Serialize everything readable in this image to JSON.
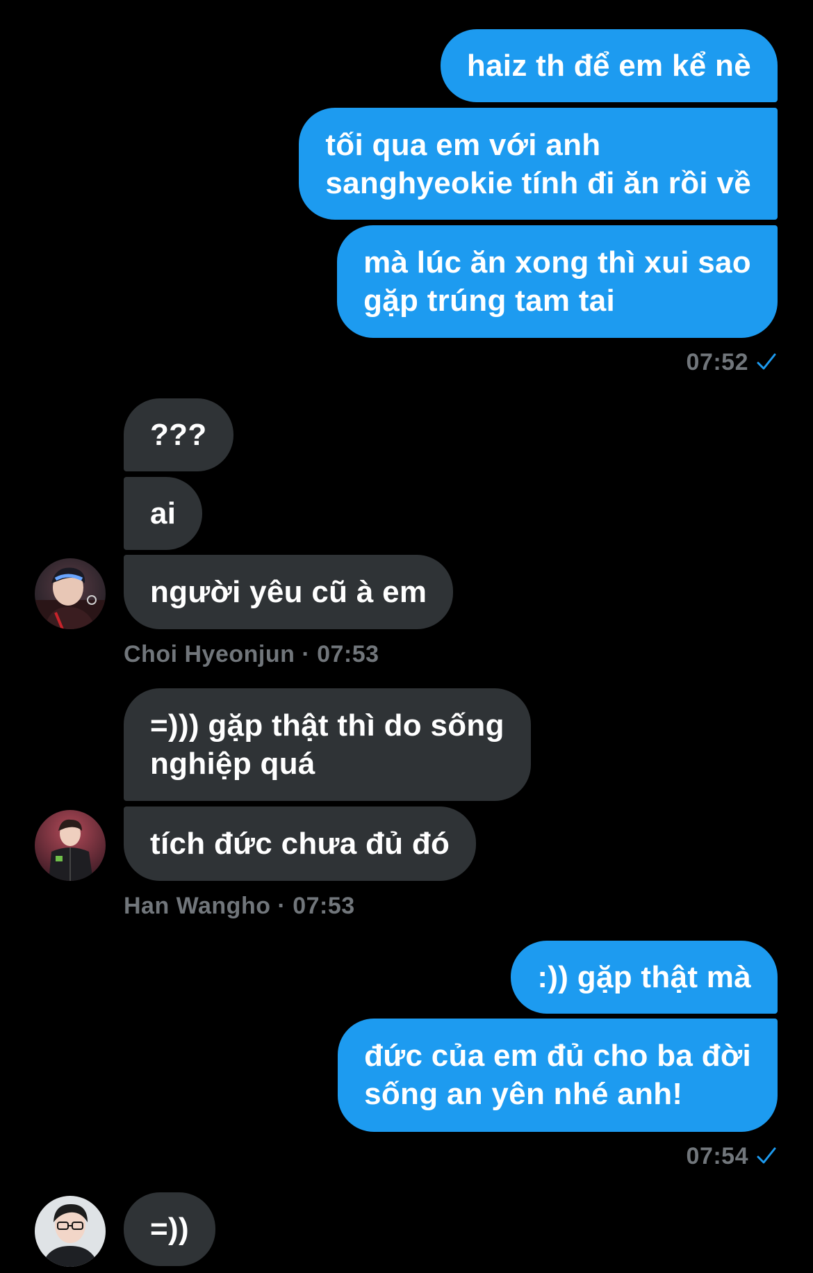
{
  "colors": {
    "background": "#000000",
    "outgoing_bubble": "#1d9bf0",
    "incoming_bubble": "#2f3336",
    "meta_text": "#71767b",
    "check": "#1d9bf0"
  },
  "messages": {
    "out1": "haiz th để em kể nè",
    "out2_line1": "tối qua em với anh",
    "out2_line2": "sanghyeokie tính đi ăn rồi về",
    "out3_line1": "mà lúc ăn xong thì xui sao",
    "out3_line2": "gặp trúng tam tai",
    "out_time1": "07:52",
    "in1": "???",
    "in2": "ai",
    "in3": "người yêu cũ à em",
    "in_meta1": "Choi Hyeonjun · 07:53",
    "in4_line1": "=))) gặp thật thì do sống",
    "in4_line2": "nghiệp quá",
    "in5": "tích đức chưa đủ đó",
    "in_meta2": "Han Wangho · 07:53",
    "out4": ":)) gặp thật mà",
    "out5_line1": "đức của em đủ cho ba đời",
    "out5_line2": "sống an yên nhé anh!",
    "out_time2": "07:54",
    "in6": "=))"
  },
  "icons": {
    "sent_check": "check-icon",
    "avatar1": "avatar-choi-hyeonjun",
    "avatar2": "avatar-han-wangho",
    "avatar3": "avatar-third-user"
  }
}
